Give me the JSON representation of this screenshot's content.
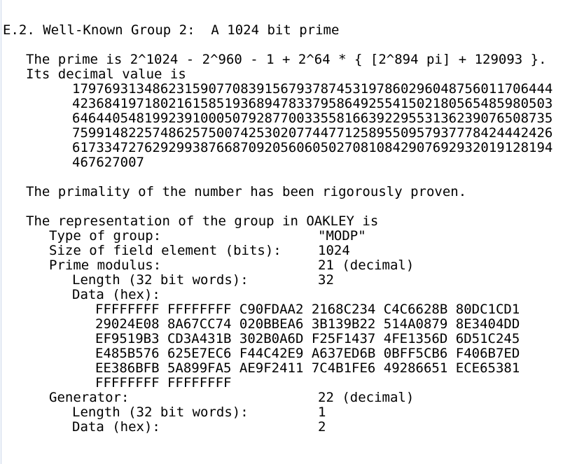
{
  "section": {
    "title": "E.2. Well-Known Group 2:  A 1024 bit prime"
  },
  "intro": {
    "prime_formula": "The prime is 2^1024 - 2^960 - 1 + 2^64 * { [2^894 pi] + 129093 }.",
    "decimal_intro": "Its decimal value is",
    "decimal_lines": [
      "179769313486231590770839156793787453197860296048756011706444",
      "423684197180216158519368947833795864925541502180565485980503",
      "646440548199239100050792877003355816639229553136239076508735",
      "759914822574862575007425302077447712589550957937778424442426",
      "617334727629299387668709205606050270810842907692932019128194",
      "467627007"
    ],
    "primality": "The primality of the number has been rigorously proven."
  },
  "oakley": {
    "heading": "The representation of the group in OAKLEY is",
    "type_label": "Type of group:",
    "type_value": "\"MODP\"",
    "size_label": "Size of field element (bits):",
    "size_value": "1024",
    "prime_mod_label": "Prime modulus:",
    "prime_mod_value": "21 (decimal)",
    "length_label": "Length (32 bit words):",
    "length_value": "32",
    "data_label": "Data (hex):",
    "hex_lines": [
      "FFFFFFFF FFFFFFFF C90FDAA2 2168C234 C4C6628B 80DC1CD1",
      "29024E08 8A67CC74 020BBEA6 3B139B22 514A0879 8E3404DD",
      "EF9519B3 CD3A431B 302B0A6D F25F1437 4FE1356D 6D51C245",
      "E485B576 625E7EC6 F44C42E9 A637ED6B 0BFF5CB6 F406B7ED",
      "EE386BFB 5A899FA5 AE9F2411 7C4B1FE6 49286651 ECE65381",
      "FFFFFFFF FFFFFFFF"
    ],
    "generator_label": "Generator:",
    "generator_value": "22 (decimal)",
    "gen_length_label": "Length (32 bit words):",
    "gen_length_value": "1",
    "gen_data_label": "Data (hex):",
    "gen_data_value": "2"
  }
}
